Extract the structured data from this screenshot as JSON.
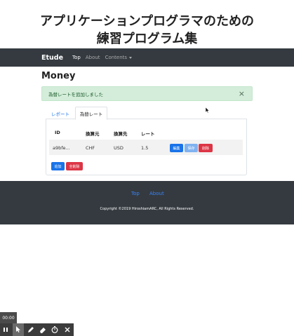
{
  "page_title_line1": "アプリケーションプログラマのための",
  "page_title_line2": "練習プログラム集",
  "navbar": {
    "brand": "Etude",
    "items": [
      {
        "label": "Top"
      },
      {
        "label": "About"
      },
      {
        "label": "Contents"
      }
    ]
  },
  "main": {
    "heading": "Money",
    "alert": {
      "message": "為替レートを追加しました",
      "close": "×"
    },
    "tabs": [
      {
        "label": "レポート"
      },
      {
        "label": "為替レート"
      }
    ],
    "table": {
      "headers": [
        "ID",
        "換算元",
        "換算先",
        "レート"
      ],
      "rows": [
        {
          "id": "a9bfe...",
          "from": "CHF",
          "to": "USD",
          "rate": "1.5"
        }
      ],
      "row_buttons": {
        "edit": "編集",
        "save": "保存",
        "delete": "削除"
      }
    },
    "actions": {
      "add": "追加",
      "delete_all": "全削除"
    }
  },
  "footer": {
    "links": [
      {
        "label": "Top"
      },
      {
        "label": "About"
      }
    ],
    "copyright": "Copyright ©2019 HiroshiamARC, All Rights Reserved."
  },
  "recorder": {
    "time": "00:00",
    "icons": [
      "pause-icon",
      "pointer-icon",
      "pen-icon",
      "eraser-icon",
      "timer-icon",
      "close-icon"
    ]
  },
  "colors": {
    "navbar": "#343a40",
    "primary": "#1a73e8",
    "danger": "#dc3545",
    "alert_bg": "#d4edda"
  }
}
